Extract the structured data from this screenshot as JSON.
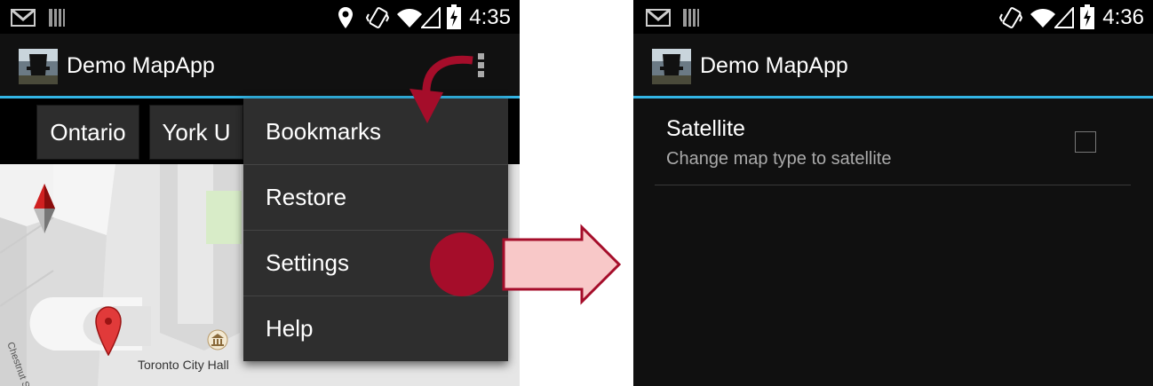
{
  "left_screen": {
    "status_bar": {
      "time": "4:35"
    },
    "action_bar": {
      "title": "Demo MapApp"
    },
    "buttons": {
      "ontario": "Ontario",
      "york": "York U"
    },
    "map": {
      "place_label": "Toronto City Hall",
      "street_label": "Chestnut St"
    },
    "menu": {
      "bookmarks": "Bookmarks",
      "restore": "Restore",
      "settings": "Settings",
      "help": "Help"
    }
  },
  "right_screen": {
    "status_bar": {
      "time": "4:36"
    },
    "action_bar": {
      "title": "Demo MapApp"
    },
    "preference": {
      "title": "Satellite",
      "summary": "Change map type to satellite",
      "checked": false
    }
  },
  "colors": {
    "accent": "#33b5e5",
    "highlight": "#a50d2a",
    "arrow_fill": "#f8c8c8",
    "menu_bg": "#2e2e2e"
  }
}
